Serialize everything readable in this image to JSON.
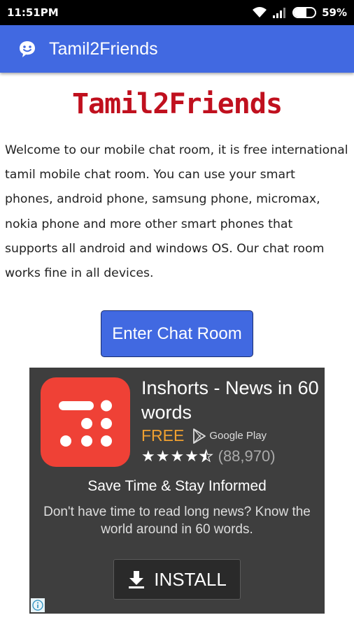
{
  "status_bar": {
    "time": "11:51PM",
    "battery_percent_label": "59%",
    "battery_level": 0.59
  },
  "app_bar": {
    "title": "Tamil2Friends",
    "icon": "smiley-icon"
  },
  "content": {
    "logo_text": "Tamil2Friends",
    "welcome_lines": [
      "Welcome to our mobile chat room, it is free international",
      "tamil mobile chat room. You can use your smart",
      "phones, android phone, samsung phone, micromax,",
      "nokia phone and more other smart phones that",
      "supports all android and windows OS. Our chat room",
      "works fine in all devices."
    ],
    "enter_button": "Enter Chat Room"
  },
  "ad": {
    "title_lines": [
      "Inshorts - News in 60",
      "words"
    ],
    "price": "FREE",
    "store_label": "Google Play",
    "rating_stars": 4.5,
    "rating_count": "(88,970)",
    "headline": "Save Time & Stay Informed",
    "body_lines": [
      "Don't have time to read long news? Know the",
      "world around in 60 words."
    ],
    "install_label": "INSTALL"
  },
  "colors": {
    "app_bar": "#4169e1",
    "logo": "#c0101e",
    "ad_background": "#3e3e3e",
    "ad_icon": "#ef4136",
    "free": "#f0a030"
  }
}
